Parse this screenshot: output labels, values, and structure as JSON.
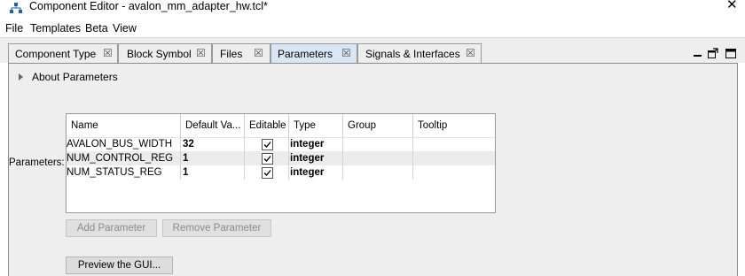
{
  "window": {
    "title": "Component Editor - avalon_mm_adapter_hw.tcl*",
    "close_glyph": "✕"
  },
  "menu": [
    "File",
    "Templates",
    "Beta",
    "View"
  ],
  "tabs": [
    {
      "label": "Component Type",
      "active": false
    },
    {
      "label": "Block Symbol",
      "active": false
    },
    {
      "label": "Files",
      "active": false
    },
    {
      "label": "Parameters",
      "active": true
    },
    {
      "label": "Signals & Interfaces",
      "active": false
    }
  ],
  "tab_close_glyph": "☒",
  "about_label": "About Parameters",
  "parameters_label": "Parameters:",
  "table": {
    "columns": [
      "Name",
      "Default Va...",
      "Editable",
      "Type",
      "Group",
      "Tooltip"
    ],
    "rows": [
      {
        "name": "AVALON_BUS_WIDTH",
        "default": "32",
        "editable": true,
        "type": "integer",
        "group": "",
        "tooltip": ""
      },
      {
        "name": "NUM_CONTROL_REG",
        "default": "1",
        "editable": true,
        "type": "integer",
        "group": "",
        "tooltip": ""
      },
      {
        "name": "NUM_STATUS_REG",
        "default": "1",
        "editable": true,
        "type": "integer",
        "group": "",
        "tooltip": ""
      }
    ]
  },
  "buttons": {
    "add_parameter": "Add Parameter",
    "remove_parameter": "Remove Parameter",
    "preview_gui": "Preview the GUI..."
  },
  "colors": {
    "active_tab": "#d9e6f3",
    "panel_bg": "#eeeeee",
    "app_icon": "#1f5fa8"
  }
}
